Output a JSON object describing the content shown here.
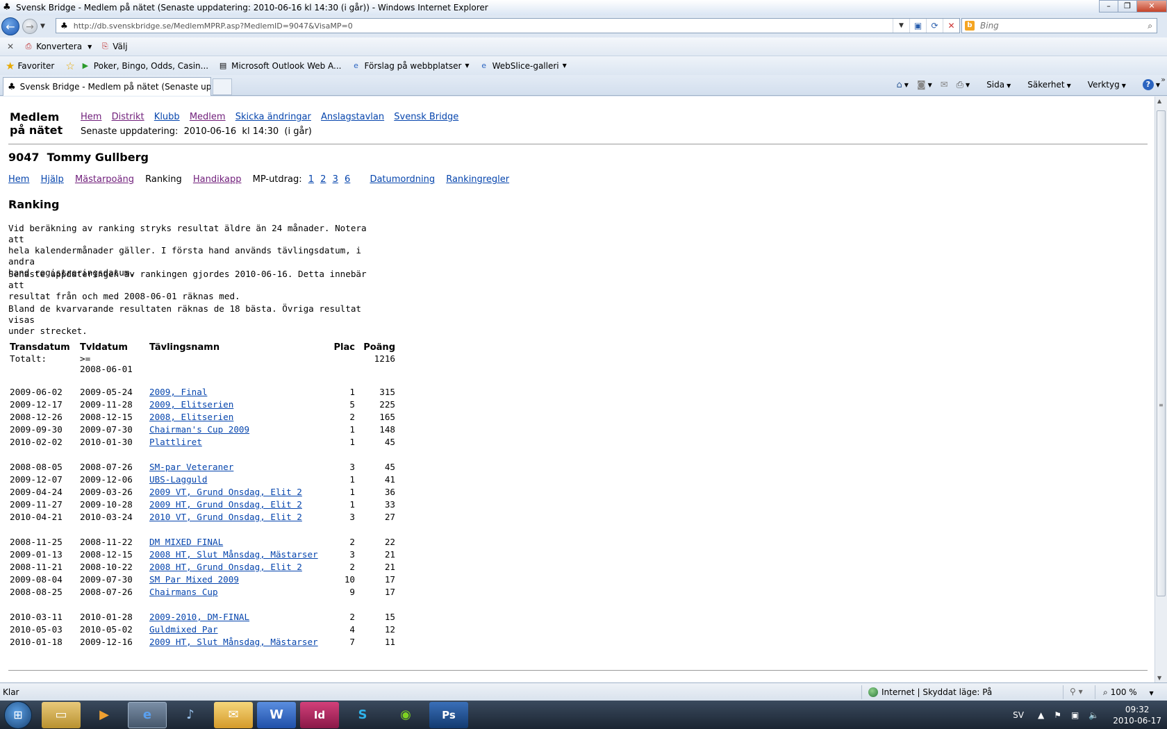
{
  "window": {
    "title": "Svensk Bridge - Medlem på nätet  (Senaste uppdatering:  2010-06-16  kl 14:30  (i går)) - Windows Internet Explorer"
  },
  "address": {
    "url": "http://db.svenskbridge.se/MedlemMPRP.asp?MedlemID=9047&VisaMP=0",
    "search_placeholder": "Bing"
  },
  "convertbar": {
    "convert_label": "Konvertera",
    "select_label": "Välj"
  },
  "favorites": {
    "label": "Favoriter",
    "links": [
      "Poker, Bingo, Odds, Casin...",
      "Microsoft Outlook Web A...",
      "Förslag på webbplatser",
      "WebSlice-galleri"
    ]
  },
  "tabs": {
    "active_label": "Svensk Bridge - Medlem på nätet  (Senaste uppd..."
  },
  "commandbar": {
    "page": "Sida",
    "safety": "Säkerhet",
    "tools": "Verktyg"
  },
  "page": {
    "logo_line1": "Medlem",
    "logo_line2": "på nätet",
    "topnav": [
      "Hem",
      "Distrikt",
      "Klubb",
      "Medlem",
      "Skicka ändringar",
      "Anslagstavlan",
      "Svensk Bridge"
    ],
    "last_update": "Senaste uppdatering:  2010-06-16  kl 14:30  (i går)",
    "member_title": "9047  Tommy Gullberg",
    "subnav": {
      "home": "Hem",
      "help": "Hjälp",
      "masterpoints": "Mästarpoäng",
      "ranking": "Ranking",
      "handicap": "Handikapp",
      "mp_label": "MP-utdrag:",
      "mp_links": [
        "1",
        "2",
        "3",
        "6"
      ],
      "date_order": "Datumordning",
      "ranking_rules": "Rankingregler"
    },
    "section_title": "Ranking",
    "para1_l1": "Vid beräkning av ranking stryks resultat äldre än 24 månader. Notera att",
    "para1_l2": "hela kalendermånader gäller. I första hand används tävlingsdatum, i andra",
    "para1_l3": "hand registreringsdatum.",
    "para2_l1": "Senaste uppdateringen av rankingen gjordes 2010-06-16. Detta innebär att",
    "para2_l2": "resultat från och med 2008-06-01 räknas med.",
    "para3_l1": "Bland de kvarvarande resultaten räknas de 18 bästa. Övriga resultat visas",
    "para3_l2": "under strecket."
  },
  "table": {
    "headers": [
      "Transdatum",
      "Tvldatum",
      "Tävlingsnamn",
      "Plac",
      "Poäng"
    ],
    "total_label": "Totalt:",
    "total_cond1": ">=",
    "total_cond2": "2008-06-01",
    "total_points": "1216",
    "rows": [
      [
        "2009-06-02",
        "2009-05-24",
        "2009, Final",
        "1",
        "315"
      ],
      [
        "2009-12-17",
        "2009-11-28",
        "2009, Elitserien",
        "5",
        "225"
      ],
      [
        "2008-12-26",
        "2008-12-15",
        "2008, Elitserien",
        "2",
        "165"
      ],
      [
        "2009-09-30",
        "2009-07-30",
        "Chairman's Cup 2009",
        "1",
        "148"
      ],
      [
        "2010-02-02",
        "2010-01-30",
        "Plattliret",
        "1",
        "45"
      ],
      [
        "2008-08-05",
        "2008-07-26",
        "SM-par Veteraner",
        "3",
        "45"
      ],
      [
        "2009-12-07",
        "2009-12-06",
        "UBS-Lagguld",
        "1",
        "41"
      ],
      [
        "2009-04-24",
        "2009-03-26",
        "2009 VT, Grund Onsdag, Elit 2",
        "1",
        "36"
      ],
      [
        "2009-11-27",
        "2009-10-28",
        "2009 HT, Grund Onsdag, Elit 2",
        "1",
        "33"
      ],
      [
        "2010-04-21",
        "2010-03-24",
        "2010 VT, Grund Onsdag, Elit 2",
        "3",
        "27"
      ],
      [
        "2008-11-25",
        "2008-11-22",
        "DM MIXED FINAL",
        "2",
        "22"
      ],
      [
        "2009-01-13",
        "2008-12-15",
        "2008 HT, Slut Månsdag, Mästarser",
        "3",
        "21"
      ],
      [
        "2008-11-21",
        "2008-10-22",
        "2008 HT, Grund Onsdag, Elit 2",
        "2",
        "21"
      ],
      [
        "2009-08-04",
        "2009-07-30",
        "SM Par Mixed 2009",
        "10",
        "17"
      ],
      [
        "2008-08-25",
        "2008-07-26",
        "Chairmans Cup",
        "9",
        "17"
      ],
      [
        "2010-03-11",
        "2010-01-28",
        "2009-2010, DM-FINAL",
        "2",
        "15"
      ],
      [
        "2010-05-03",
        "2010-05-02",
        "Guldmixed Par",
        "4",
        "12"
      ],
      [
        "2010-01-18",
        "2009-12-16",
        "2009 HT, Slut Månsdag, Mästarser",
        "7",
        "11"
      ]
    ]
  },
  "statusbar": {
    "status": "Klar",
    "zone": "Internet | Skyddat läge: På",
    "zoom": "100 %"
  },
  "taskbar": {
    "lang": "SV",
    "time": "09:32",
    "date": "2010-06-17",
    "apps": [
      "explorer",
      "media-player",
      "internet-explorer",
      "itunes",
      "outlook",
      "word",
      "indesign",
      "skype",
      "spotify",
      "photoshop"
    ]
  },
  "colors": {
    "link": "#0645ad",
    "visited": "#6f1d7a"
  }
}
